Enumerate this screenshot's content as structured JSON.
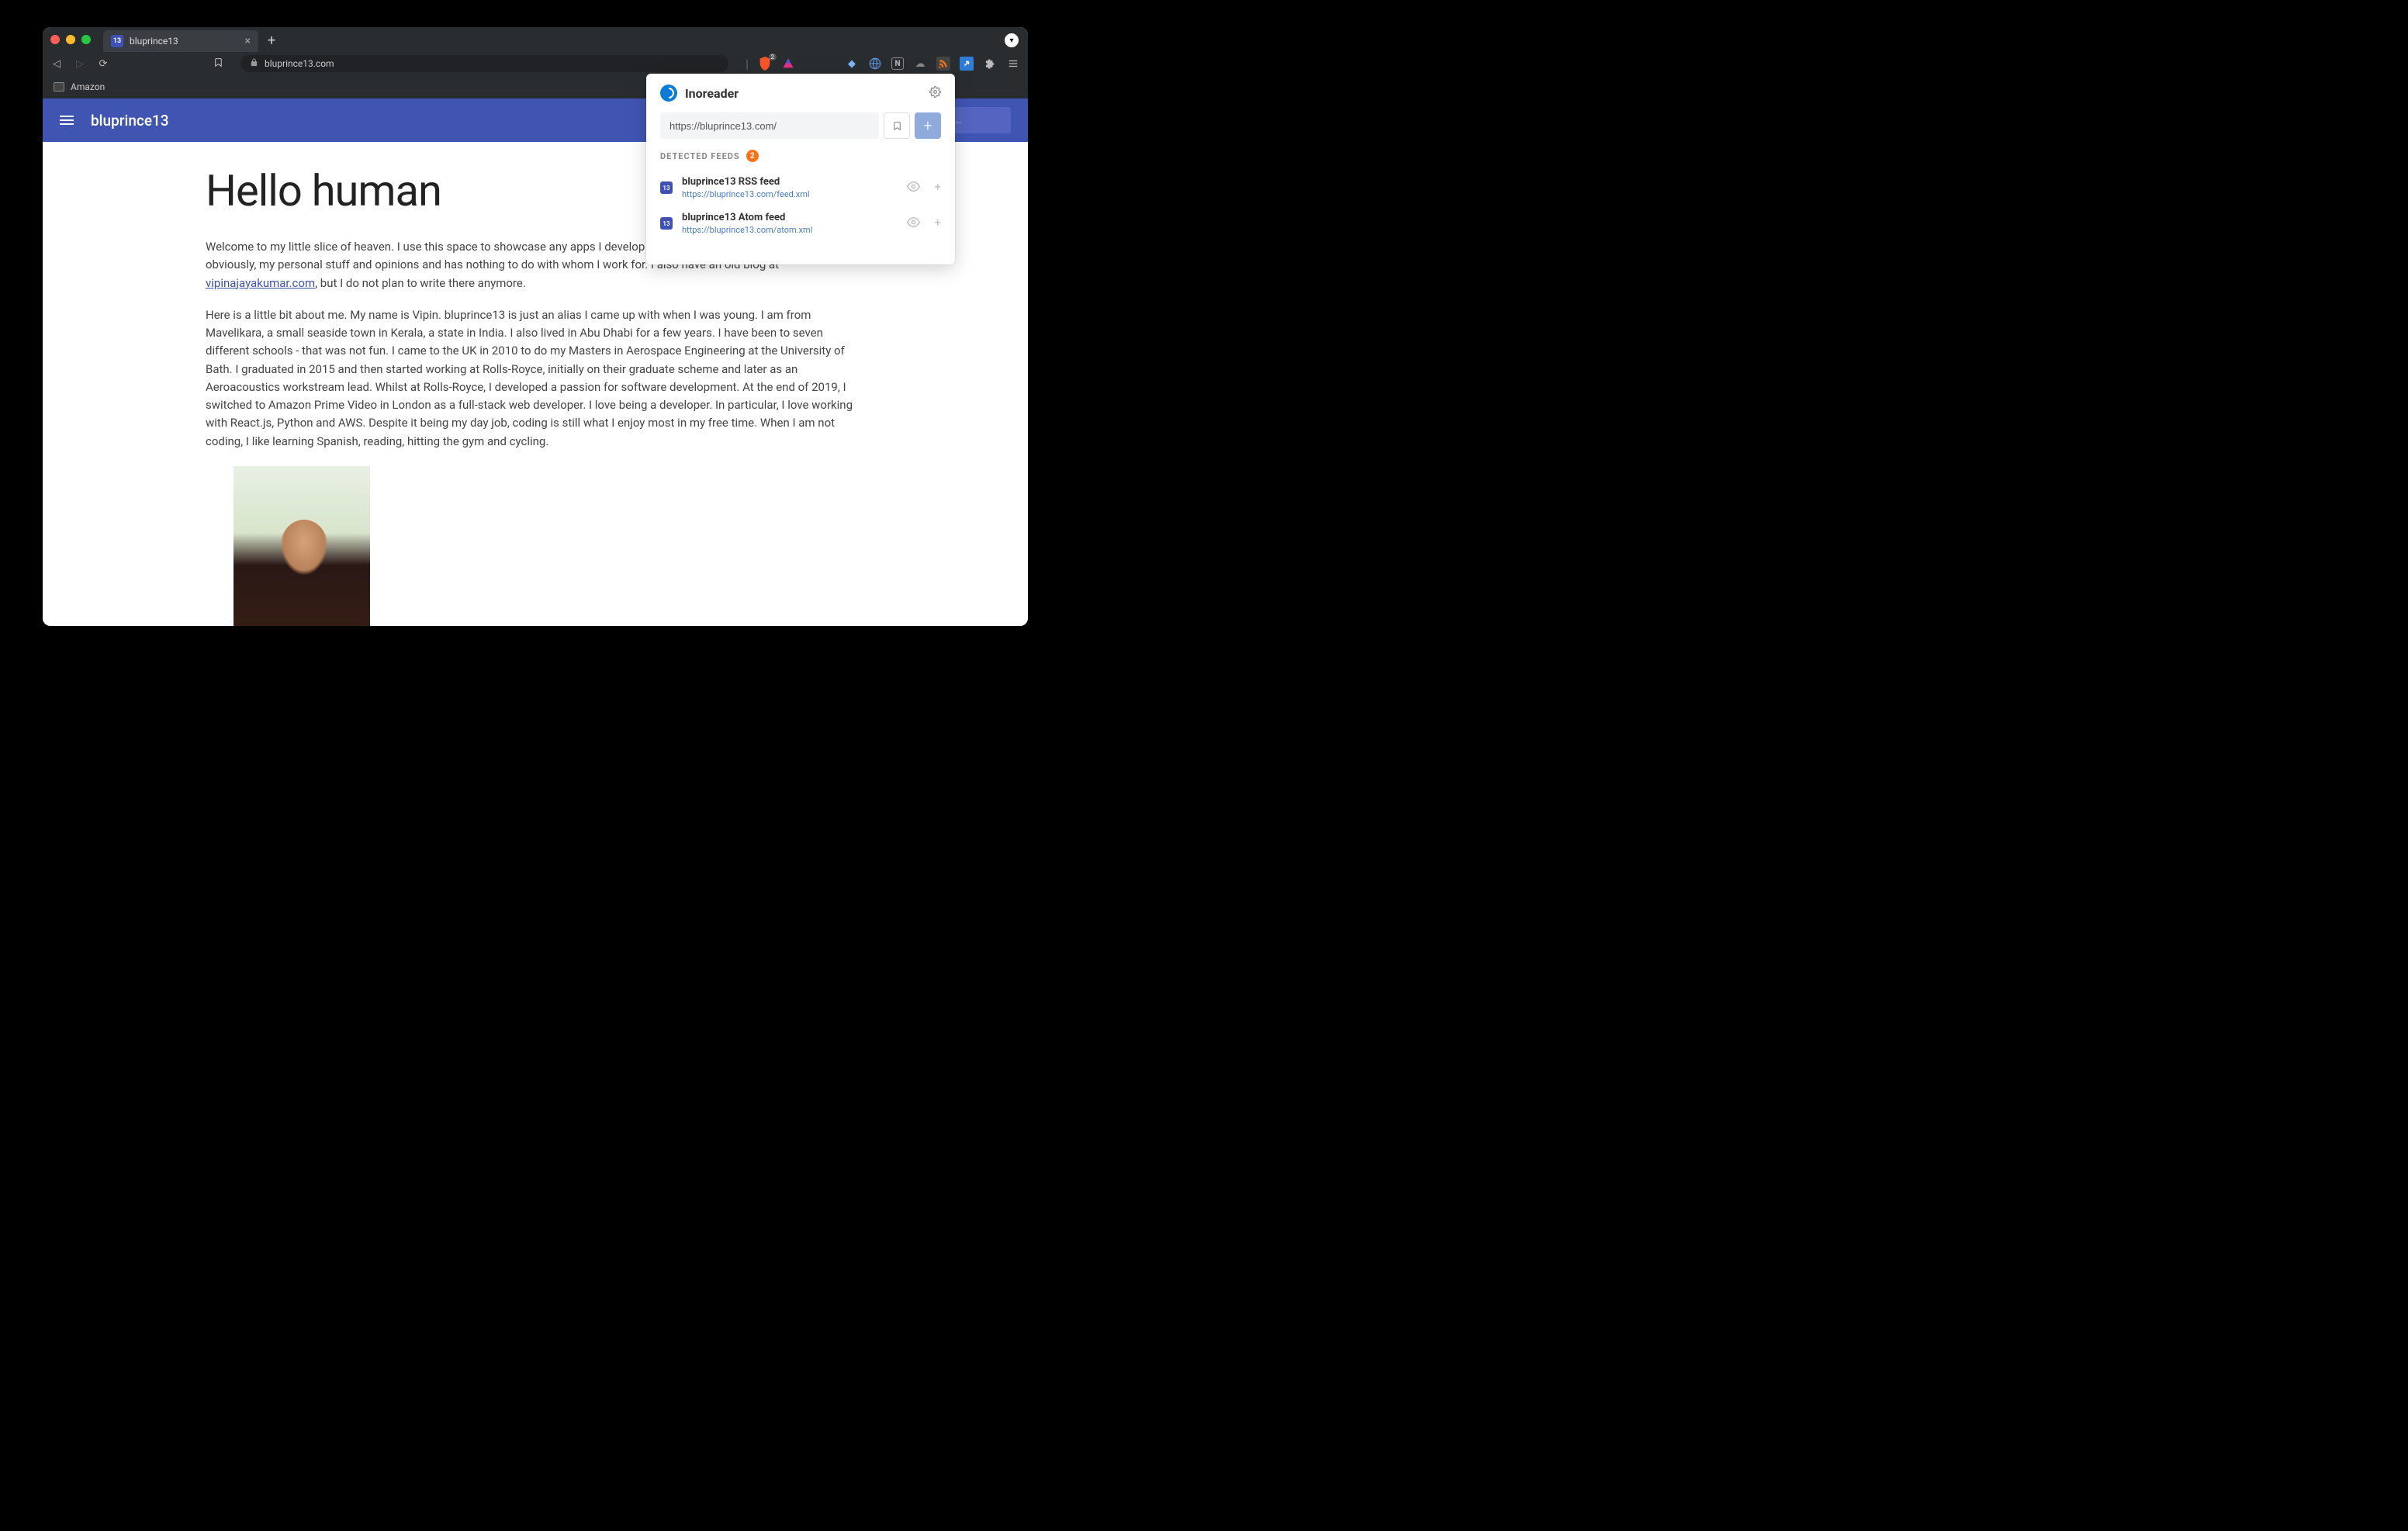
{
  "browser": {
    "tab_title": "bluprince13",
    "tab_favicon_text": "13",
    "url_display": "bluprince13.com",
    "bookmarks": [
      "Amazon"
    ],
    "brave_shield_count": "2"
  },
  "page": {
    "site_title": "bluprince13",
    "search_placeholder": "ch...",
    "heading": "Hello human",
    "para1_a": "Welcome to my little slice of heaven. I use this space to showcase any apps I develop and to blog. Everything I write here is, obviously, my personal stuff and opinions and has nothing to do with whom I work for. I also have an old blog at ",
    "para1_link": "vipinajayakumar.com",
    "para1_b": ", but I do not plan to write there anymore.",
    "para2": "Here is a little bit about me. My name is Vipin. bluprince13 is just an alias I came up with when I was young. I am from Mavelikara, a small seaside town in Kerala, a state in India. I also lived in Abu Dhabi for a few years. I have been to seven different schools - that was not fun. I came to the UK in 2010 to do my Masters in Aerospace Engineering at the University of Bath. I graduated in 2015 and then started working at Rolls-Royce, initially on their graduate scheme and later as an Aeroacoustics workstream lead. Whilst at Rolls-Royce, I developed a passion for software development. At the end of 2019, I switched to Amazon Prime Video in London as a full-stack web developer. I love being a developer. In particular, I love working with React.js, Python and AWS. Despite it being my day job, coding is still what I enjoy most in my free time. When I am not coding, I like learning Spanish, reading, hitting the gym and cycling."
  },
  "popup": {
    "title": "Inoreader",
    "url_value": "https://bluprince13.com/",
    "detected_label": "DETECTED FEEDS",
    "detected_count": "2",
    "feeds": [
      {
        "favicon": "13",
        "title": "bluprince13 RSS feed",
        "url": "https://bluprince13.com/feed.xml"
      },
      {
        "favicon": "13",
        "title": "bluprince13 Atom feed",
        "url": "https://bluprince13.com/atom.xml"
      }
    ]
  }
}
